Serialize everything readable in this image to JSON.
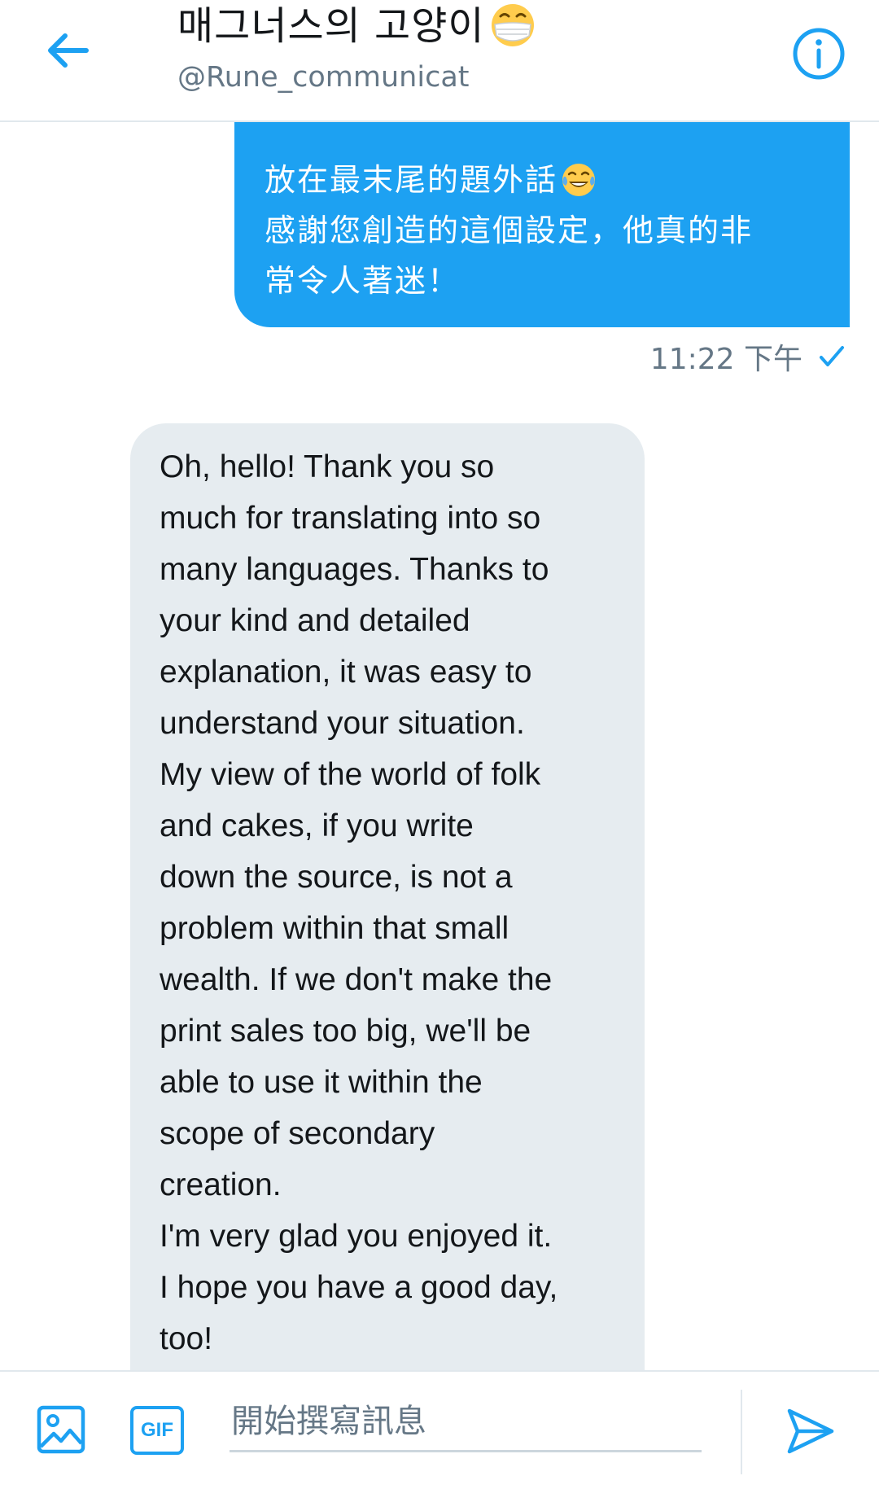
{
  "header": {
    "title": "매그너스의 고양이",
    "handle": "@Rune_communicat",
    "back_icon": "arrow-left-icon",
    "info_icon": "info-circle-icon",
    "title_emoji": "mask-face-emoji"
  },
  "conversation": {
    "sent_message": {
      "lines": [
        "放在最末尾的題外話",
        "感謝您創造的這個設定，他真的非",
        "常令人著迷！"
      ],
      "emoji": "joy-tears-emoji",
      "time": "11:22 下午",
      "status_icon": "check-icon"
    },
    "received_message": {
      "lines": [
        "Oh, hello! Thank you so",
        "much for translating into so",
        "many languages. Thanks to",
        "your kind and detailed",
        "explanation, it was easy to",
        "understand your situation.",
        "My view of the world of folk",
        "and cakes, if you write",
        "down the source, is not a",
        "problem within that small",
        "wealth. If we don't make the",
        "print sales too big, we'll be",
        "able to use it within the",
        "scope of secondary",
        "creation.",
        "I'm very glad you enjoyed it.",
        "I hope you have a good day,",
        "too!"
      ]
    }
  },
  "composer": {
    "placeholder": "開始撰寫訊息",
    "gif_label": "GIF",
    "media_icon": "image-icon",
    "send_icon": "send-icon"
  },
  "colors": {
    "accent": "#1da1f2",
    "received_bubble": "#e6ecf0",
    "secondary_text": "#657786",
    "divider": "#e1e8ed"
  }
}
